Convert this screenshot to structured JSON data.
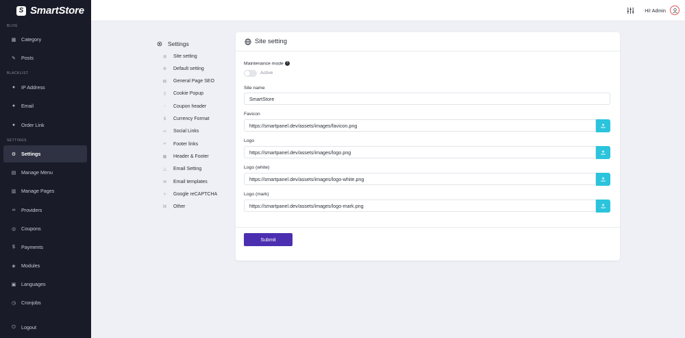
{
  "brand": {
    "name": "SmartStore",
    "logo_letter": "S"
  },
  "sidebar": {
    "sections": [
      "BLOG",
      "BLACKLIST",
      "SETTINGS"
    ],
    "items": [
      {
        "label": "Category",
        "icon": "grid-icon"
      },
      {
        "label": "Posts",
        "icon": "edit-icon"
      },
      {
        "label": "IP Address",
        "icon": "user-block-icon"
      },
      {
        "label": "Email",
        "icon": "user-block-icon"
      },
      {
        "label": "Order Link",
        "icon": "user-block-icon"
      },
      {
        "label": "Settings",
        "icon": "gear-icon",
        "active": true
      },
      {
        "label": "Manage Menu",
        "icon": "menu-icon"
      },
      {
        "label": "Manage Pages",
        "icon": "pages-icon"
      },
      {
        "label": "Providers",
        "icon": "link-icon"
      },
      {
        "label": "Coupons",
        "icon": "coupon-icon"
      },
      {
        "label": "Payments",
        "icon": "dollar-icon"
      },
      {
        "label": "Modules",
        "icon": "box-icon"
      },
      {
        "label": "Languages",
        "icon": "language-icon"
      },
      {
        "label": "Cronjobs",
        "icon": "clock-icon"
      },
      {
        "label": "Logout",
        "icon": "logout-icon"
      }
    ]
  },
  "topbar": {
    "greeting": "Hi! Admin"
  },
  "submenu": {
    "title": "Settings",
    "items": [
      {
        "label": "Site setting",
        "icon": "globe-icon"
      },
      {
        "label": "Default setting",
        "icon": "gear-icon"
      },
      {
        "label": "General Page SEO",
        "icon": "doc-icon"
      },
      {
        "label": "Cookie Popup",
        "icon": "bookmark-icon"
      },
      {
        "label": "Coupon header",
        "icon": "tag-icon"
      },
      {
        "label": "Currency Format",
        "icon": "dollar-icon"
      },
      {
        "label": "Social Links",
        "icon": "link-icon"
      },
      {
        "label": "Footer links",
        "icon": "link-icon"
      },
      {
        "label": "Header & Footer",
        "icon": "layout-icon"
      },
      {
        "label": "Email Setting",
        "icon": "bell-icon"
      },
      {
        "label": "Email templates",
        "icon": "mail-icon"
      },
      {
        "label": "Google reCAPTCHA",
        "icon": "captcha-icon"
      },
      {
        "label": "Other",
        "icon": "command-icon"
      }
    ]
  },
  "card": {
    "title": "Site setting",
    "maintenance_label": "Maintenance mode",
    "maintenance_toggle": "Active",
    "site_name_label": "Site name",
    "site_name_value": "SmartStore",
    "favicon_label": "Favicon",
    "favicon_value": "https://smartpanel.dev/assets/images/favicon.png",
    "logo_label": "Logo",
    "logo_value": "https://smartpanel.dev/assets/images/logo.png",
    "logo_white_label": "Logo (white)",
    "logo_white_value": "https://smartpanel.dev/assets/images/logo-white.png",
    "logo_mark_label": "Logo (mark)",
    "logo_mark_value": "https://smartpanel.dev/assets/images/logo-mark.png",
    "submit_label": "Submit"
  },
  "colors": {
    "sidebar_bg": "#191c28",
    "accent": "#4b2fb0",
    "upload": "#2bc4dc"
  }
}
